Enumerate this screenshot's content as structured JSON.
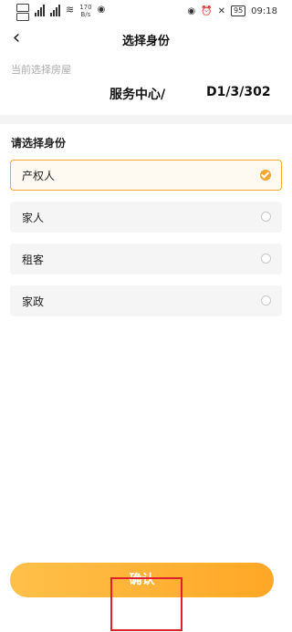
{
  "statusbar": {
    "net_speed": "170",
    "net_unit": "B/s",
    "battery": "95",
    "time": "09:18"
  },
  "nav": {
    "title": "选择身份"
  },
  "house": {
    "label": "当前选择房屋",
    "name_a": "服务中心/",
    "name_b": "D1/3/302"
  },
  "identity": {
    "title": "请选择身份",
    "options": [
      {
        "label": "产权人",
        "selected": true
      },
      {
        "label": "家人",
        "selected": false
      },
      {
        "label": "租客",
        "selected": false
      },
      {
        "label": "家政",
        "selected": false
      }
    ]
  },
  "confirm": {
    "label": "确认"
  },
  "colors": {
    "accent": "#f4a630",
    "highlight": "#e0202a"
  }
}
